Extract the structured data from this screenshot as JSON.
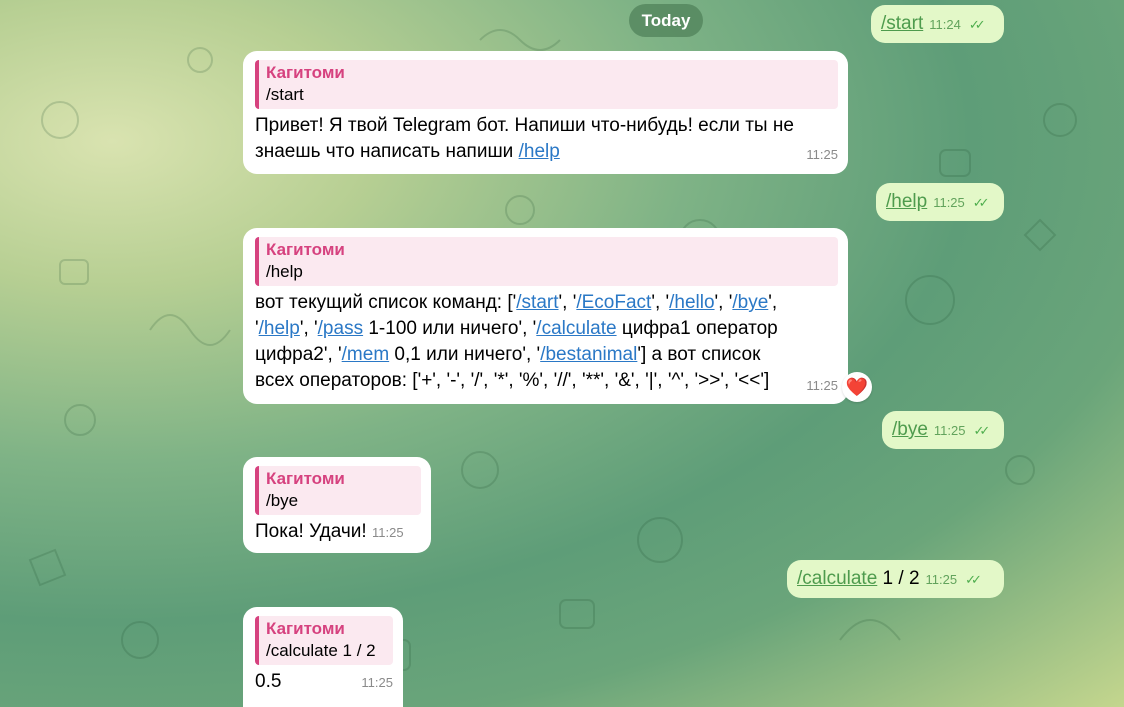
{
  "date_label": "Today",
  "messages": {
    "m1": {
      "text": "/start",
      "time": "11:24",
      "checks": "✓✓"
    },
    "m2": {
      "reply_author": "Кагитоми",
      "reply_text": "/start",
      "text_before": "Привет! Я твой Telegram бот. Напиши что-нибудь! если ты не знаешь что написать напиши ",
      "link": "/help",
      "time": "11:25"
    },
    "m3": {
      "text": "/help",
      "time": "11:25",
      "checks": "✓✓"
    },
    "m4": {
      "reply_author": "Кагитоми",
      "reply_text": "/help",
      "t1": "вот текущий список команд: ['",
      "l1": "/start",
      "t2": "', '",
      "l2": "/EcoFact",
      "t3": "', '",
      "l3": "/hello",
      "t4": "', '",
      "l4": "/bye",
      "t5": "', '",
      "l5": "/help",
      "t6": "', '",
      "l6": "/pass",
      "t7": " 1-100 или ничего', '",
      "l7": "/calculate",
      "t8": " цифра1 оператор цифра2', '",
      "l8": "/mem",
      "t9": " 0,1 или ничего', '",
      "l9": "/bestanimal",
      "t10": "'] а вот список всех операторов: ['+', '-', '/', '*', '%', '//', '**', '&', '|', '^', '>>', '<<']",
      "time": "11:25",
      "reaction": "❤️"
    },
    "m5": {
      "text": "/bye",
      "time": "11:25",
      "checks": "✓✓"
    },
    "m6": {
      "reply_author": "Кагитоми",
      "reply_text": "/bye",
      "text": "Пока! Удачи!",
      "time": "11:25"
    },
    "m7": {
      "link": "/calculate",
      "text": " 1 / 2",
      "time": "11:25",
      "checks": "✓✓"
    },
    "m8": {
      "reply_author": "Кагитоми",
      "reply_text": "/calculate 1 / 2",
      "text": "0.5",
      "time": "11:25"
    }
  }
}
